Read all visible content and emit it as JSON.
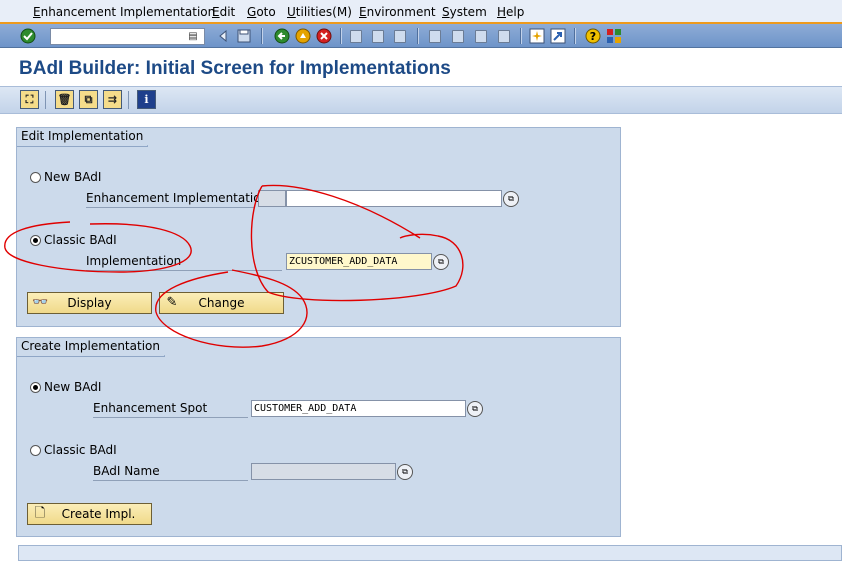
{
  "menubar": {
    "items": [
      "Enhancement Implementation",
      "Edit",
      "Goto",
      "Utilities(M)",
      "Environment",
      "System",
      "Help"
    ]
  },
  "toolbar": {
    "icons": [
      "enter-icon",
      "command-field",
      "back-icon",
      "exit-icon",
      "cancel-icon",
      "print-icon",
      "find-icon",
      "find-next-icon",
      "first-page-icon",
      "previous-page-icon",
      "next-page-icon",
      "last-page-icon",
      "new-session-icon",
      "shortcut-icon",
      "help-icon",
      "customize-layout-icon"
    ]
  },
  "page": {
    "title": "BAdI Builder: Initial Screen for Implementations"
  },
  "edit_group": {
    "title": "Edit Implementation",
    "new_badi_label": "New BAdI",
    "enh_impl_label": "Enhancement Implementation",
    "enh_impl_value": "",
    "classic_badi_label": "Classic BAdI",
    "implementation_label": "Implementation",
    "implementation_value": "ZCUSTOMER_ADD_DATA",
    "display_label": "Display",
    "change_label": "Change",
    "selected": "classic"
  },
  "create_group": {
    "title": "Create Implementation",
    "new_badi_label": "New BAdI",
    "enh_spot_label": "Enhancement Spot",
    "enh_spot_value": "CUSTOMER_ADD_DATA",
    "classic_badi_label": "Classic BAdI",
    "badi_name_label": "BAdI Name",
    "badi_name_value": "",
    "create_label": "Create Impl.",
    "selected": "new"
  },
  "colors": {
    "title": "#1d4a86",
    "annotation": "#e00000",
    "menu_accent": "#ee9a1c"
  }
}
